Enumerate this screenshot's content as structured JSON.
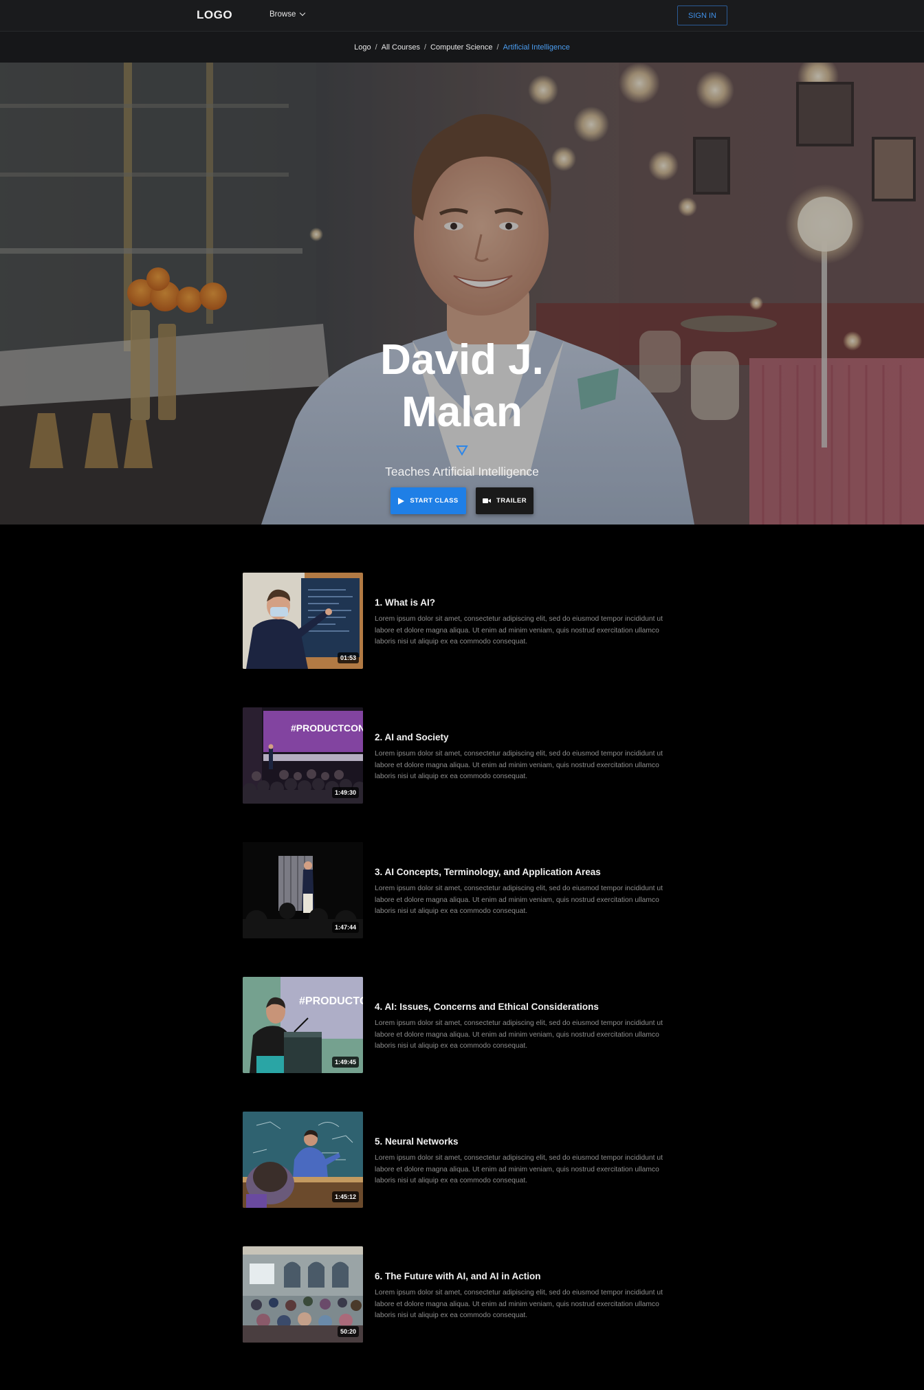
{
  "nav": {
    "logo": "LOGO",
    "browse_label": "Browse",
    "signin_label": "SIGN IN"
  },
  "breadcrumb": [
    "Logo",
    "All Courses",
    "Computer Science",
    "Artificial Intelligence"
  ],
  "hero": {
    "name_line1": "David J.",
    "name_line2": "Malan",
    "subtitle": "Teaches Artificial Intelligence",
    "start_label": "START CLASS",
    "trailer_label": "TRAILER"
  },
  "lessons": [
    {
      "title": "1. What is AI?",
      "duration": "01:53",
      "description": "Lorem ipsum dolor sit amet, consectetur adipiscing elit, sed do eiusmod tempor incididunt ut labore et dolore magna aliqua. Ut enim ad minim veniam, quis nostrud exercitation ullamco laboris nisi ut aliquip ex ea commodo consequat."
    },
    {
      "title": "2. AI and Society",
      "duration": "1:49:30",
      "description": "Lorem ipsum dolor sit amet, consectetur adipiscing elit, sed do eiusmod tempor incididunt ut labore et dolore magna aliqua. Ut enim ad minim veniam, quis nostrud exercitation ullamco laboris nisi ut aliquip ex ea commodo consequat."
    },
    {
      "title": "3. AI Concepts, Terminology, and Application Areas",
      "duration": "1:47:44",
      "description": "Lorem ipsum dolor sit amet, consectetur adipiscing elit, sed do eiusmod tempor incididunt ut labore et dolore magna aliqua. Ut enim ad minim veniam, quis nostrud exercitation ullamco laboris nisi ut aliquip ex ea commodo consequat."
    },
    {
      "title": "4. AI: Issues, Concerns and Ethical Considerations",
      "duration": "1:49:45",
      "description": "Lorem ipsum dolor sit amet, consectetur adipiscing elit, sed do eiusmod tempor incididunt ut labore et dolore magna aliqua. Ut enim ad minim veniam, quis nostrud exercitation ullamco laboris nisi ut aliquip ex ea commodo consequat."
    },
    {
      "title": "5. Neural Networks",
      "duration": "1:45:12",
      "description": "Lorem ipsum dolor sit amet, consectetur adipiscing elit, sed do eiusmod tempor incididunt ut labore et dolore magna aliqua. Ut enim ad minim veniam, quis nostrud exercitation ullamco laboris nisi ut aliquip ex ea commodo consequat."
    },
    {
      "title": "6. The Future with AI, and AI in Action",
      "duration": "50:20",
      "description": "Lorem ipsum dolor sit amet, consectetur adipiscing elit, sed do eiusmod tempor incididunt ut labore et dolore magna aliqua. Ut enim ad minim veniam, quis nostrud exercitation ullamco laboris nisi ut aliquip ex ea commodo consequat."
    }
  ],
  "thumb_text": {
    "lesson2_screen": "#PRODUCTCON",
    "lesson4_screen": "#PRODUCTCON"
  },
  "colors": {
    "accent": "#1f7fe6",
    "breadcrumb_active": "#4b9df0",
    "page_bg": "#000000",
    "nav_bg": "#1a1b1d"
  }
}
